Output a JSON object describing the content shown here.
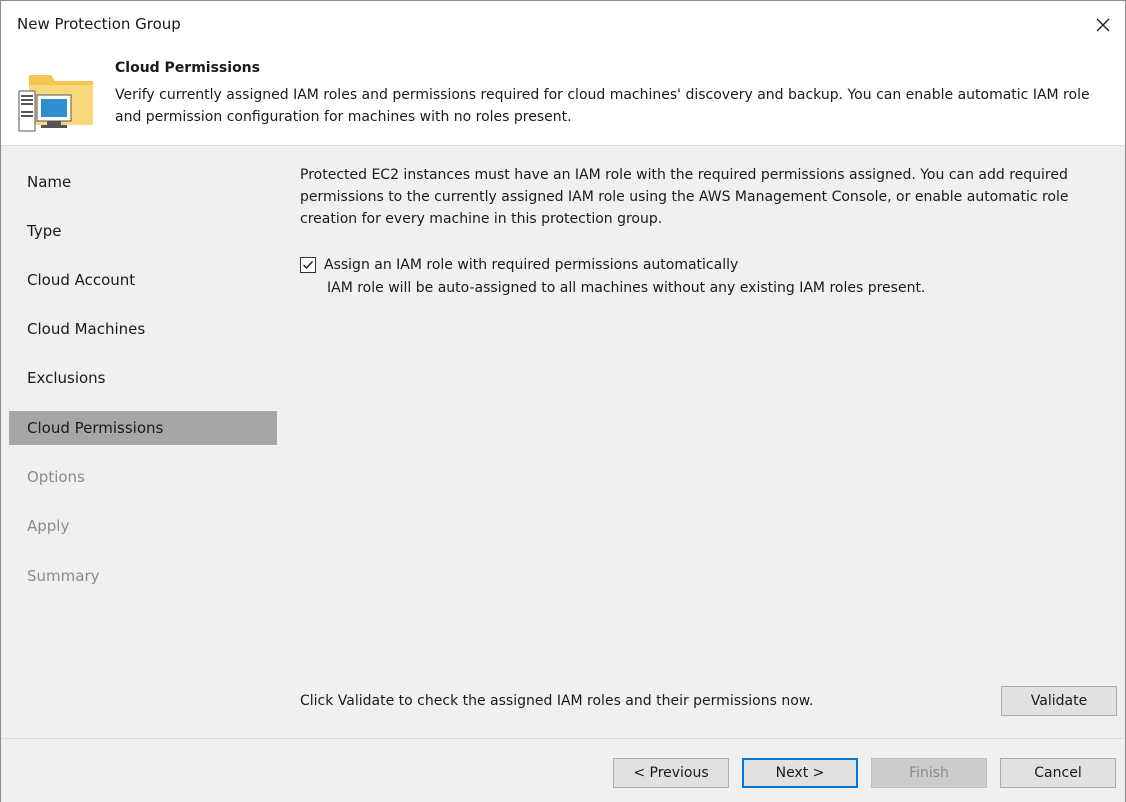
{
  "window": {
    "title": "New Protection Group"
  },
  "header": {
    "title": "Cloud Permissions",
    "description": "Verify currently assigned IAM roles and permissions required for cloud machines' discovery and backup. You can enable automatic IAM role and permission configuration for machines with no roles present."
  },
  "steps": [
    {
      "label": "Name",
      "state": "done"
    },
    {
      "label": "Type",
      "state": "done"
    },
    {
      "label": "Cloud Account",
      "state": "done"
    },
    {
      "label": "Cloud Machines",
      "state": "done"
    },
    {
      "label": "Exclusions",
      "state": "done"
    },
    {
      "label": "Cloud Permissions",
      "state": "active"
    },
    {
      "label": "Options",
      "state": "disabled"
    },
    {
      "label": "Apply",
      "state": "disabled"
    },
    {
      "label": "Summary",
      "state": "disabled"
    }
  ],
  "content": {
    "intro": "Protected EC2 instances must have an IAM role with the required permissions assigned. You can add required permissions to the currently assigned IAM role using the AWS Management Console, or enable automatic role creation for every machine in this protection group.",
    "checkbox_label": "Assign an IAM role with required permissions automatically",
    "checkbox_checked": true,
    "checkbox_sub": "IAM role will be auto-assigned to all machines without any existing IAM roles present.",
    "validate_text": "Click Validate to check the assigned IAM roles and their permissions now.",
    "validate_button": "Validate"
  },
  "footer": {
    "previous": "< Previous",
    "next": "Next >",
    "finish": "Finish",
    "cancel": "Cancel"
  },
  "icons": {
    "close": "close-icon",
    "header": "folder-computer-icon",
    "check": "checkmark-icon"
  },
  "colors": {
    "active_step": "#a6a6a6",
    "primary_border": "#0078d7",
    "folder": "#f5c453"
  }
}
